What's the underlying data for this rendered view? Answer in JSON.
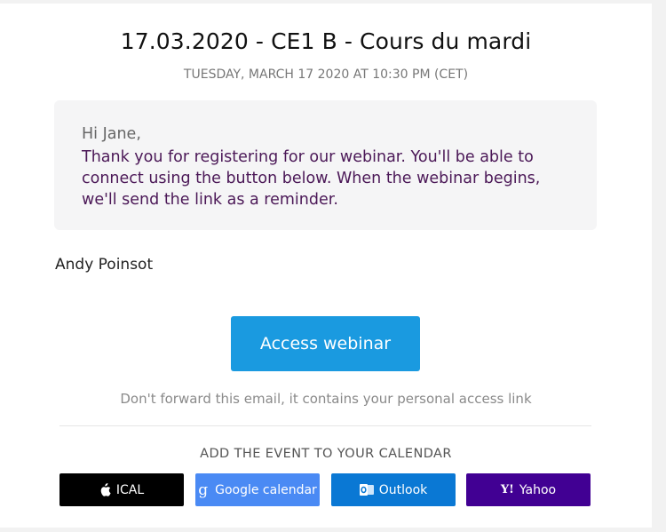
{
  "email": {
    "title": "17.03.2020 - CE1 B - Cours du mardi",
    "datetime": "TUESDAY, MARCH 17 2020 AT 10:30 PM (CET)",
    "greeting": "Hi Jane,",
    "message": "Thank you for registering for our webinar. You'll be able to connect using the button below. When the webinar begins, we'll send the link as a reminder.",
    "sender": "Andy Poinsot",
    "access_button": "Access webinar",
    "notice": "Don't forward this email, it contains your personal access link"
  },
  "calendar": {
    "heading": "ADD THE EVENT TO YOUR CALENDAR",
    "buttons": [
      {
        "label": "ICAL",
        "icon": "apple-icon",
        "color": "#000000"
      },
      {
        "label": "Google calendar",
        "icon": "google-icon",
        "color": "#4a8af4"
      },
      {
        "label": "Outlook",
        "icon": "outlook-icon",
        "color": "#0a78d4"
      },
      {
        "label": "Yahoo",
        "icon": "yahoo-icon",
        "color": "#410093"
      }
    ]
  },
  "colors": {
    "accent": "#1a9ae0",
    "message_text": "#4b1857"
  }
}
